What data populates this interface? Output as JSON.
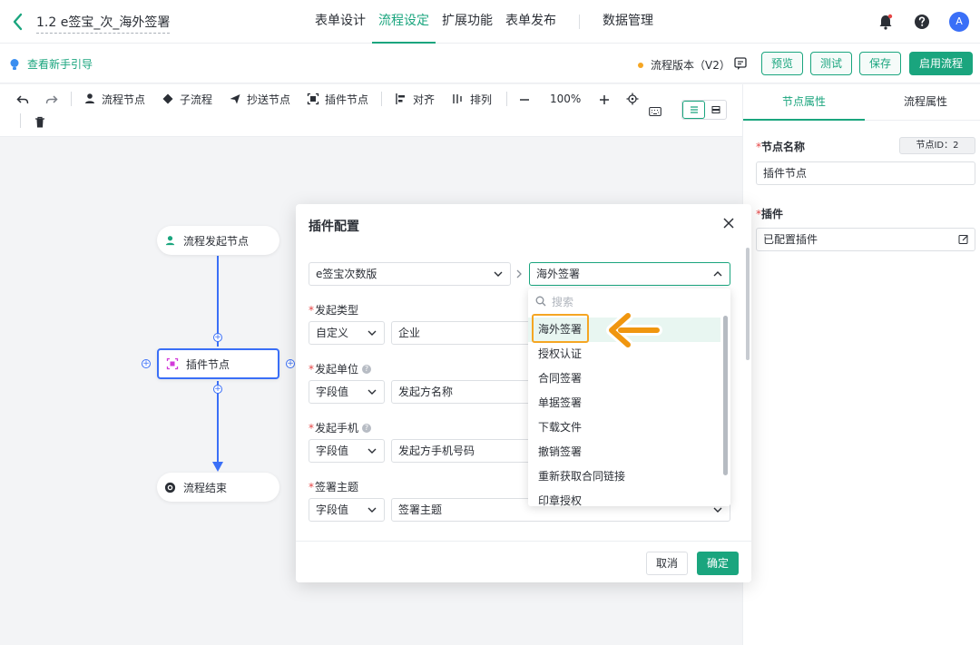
{
  "header": {
    "title": "1.2 e签宝_次_海外签署",
    "tabs": [
      "表单设计",
      "流程设定",
      "扩展功能",
      "表单发布"
    ],
    "active_tab": "流程设定",
    "data_tab": "数据管理",
    "avatar_letter": "A",
    "icons": [
      "back-chevron-icon",
      "bell-icon",
      "help-icon"
    ]
  },
  "subbar": {
    "guide_label": "查看新手引导",
    "version_label": "流程版本（V2）",
    "buttons": {
      "preview": "预览",
      "test": "测试",
      "save": "保存",
      "enable": "启用流程"
    }
  },
  "toolbar": {
    "process_node": "流程节点",
    "sub_process": "子流程",
    "cc_node": "抄送节点",
    "plugin_node": "插件节点",
    "align": "对齐",
    "arrange": "排列",
    "zoom": "100%"
  },
  "canvas": {
    "start_node": "流程发起节点",
    "plugin_node": "插件节点",
    "end_node": "流程结束"
  },
  "right_panel": {
    "tab_node": "节点属性",
    "tab_flow": "流程属性",
    "node_name_label": "节点名称",
    "node_id": "节点ID：2",
    "node_name_value": "插件节点",
    "plugin_label": "插件",
    "plugin_value": "已配置插件"
  },
  "modal": {
    "title": "插件配置",
    "plugin_select": "e签宝次数版",
    "action_select": "海外签署",
    "fields": [
      {
        "label": "发起类型",
        "type": "自定义",
        "value": "企业",
        "help": false
      },
      {
        "label": "发起单位",
        "type": "字段值",
        "value": "发起方名称",
        "help": true
      },
      {
        "label": "发起手机",
        "type": "字段值",
        "value": "发起方手机号码",
        "help": true
      },
      {
        "label": "签署主题",
        "type": "字段值",
        "value": "签署主题",
        "help": false
      }
    ],
    "cancel": "取消",
    "ok": "确定"
  },
  "dropdown": {
    "search_placeholder": "搜索",
    "options": [
      "海外签署",
      "授权认证",
      "合同签署",
      "单据签署",
      "下载文件",
      "撤销签署",
      "重新获取合同链接",
      "印章授权"
    ],
    "selected": "海外签署"
  },
  "colors": {
    "accent": "#1aa57e",
    "selection_blue": "#3a6ff7",
    "annotation_orange": "#f5a623",
    "required_red": "#e54545"
  }
}
